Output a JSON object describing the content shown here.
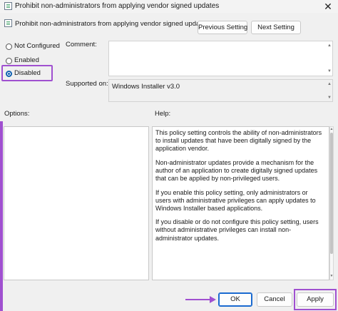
{
  "window": {
    "title": "Prohibit non-administrators from applying vendor signed updates",
    "close_glyph": "✕"
  },
  "header": {
    "policy_title": "Prohibit non-administrators from applying vendor signed updates",
    "previous_label": "Previous Setting",
    "next_label": "Next Setting"
  },
  "state": {
    "options": [
      "Not Configured",
      "Enabled",
      "Disabled"
    ],
    "selected": "Disabled"
  },
  "fields": {
    "comment_label": "Comment:",
    "comment_value": "",
    "supported_label": "Supported on:",
    "supported_value": "Windows Installer v3.0"
  },
  "panels": {
    "options_label": "Options:",
    "help_label": "Help:",
    "help_paragraphs": [
      "This policy setting controls the ability of non-administrators to install updates that have been digitally signed by the application vendor.",
      "Non-administrator updates provide a mechanism for the author of an application to create digitally signed updates that can be applied by non-privileged users.",
      "If you enable this policy setting, only administrators or users with administrative privileges can apply updates to Windows Installer based applications.",
      "If you disable or do not configure this policy setting, users without administrative privileges can install non-administrator updates."
    ]
  },
  "footer": {
    "ok_label": "OK",
    "cancel_label": "Cancel",
    "apply_label": "Apply"
  },
  "icons": {
    "scroll_up": "▲",
    "scroll_down": "▼"
  },
  "colors": {
    "highlight": "#a050d0",
    "accent_blue": "#1061b0"
  }
}
